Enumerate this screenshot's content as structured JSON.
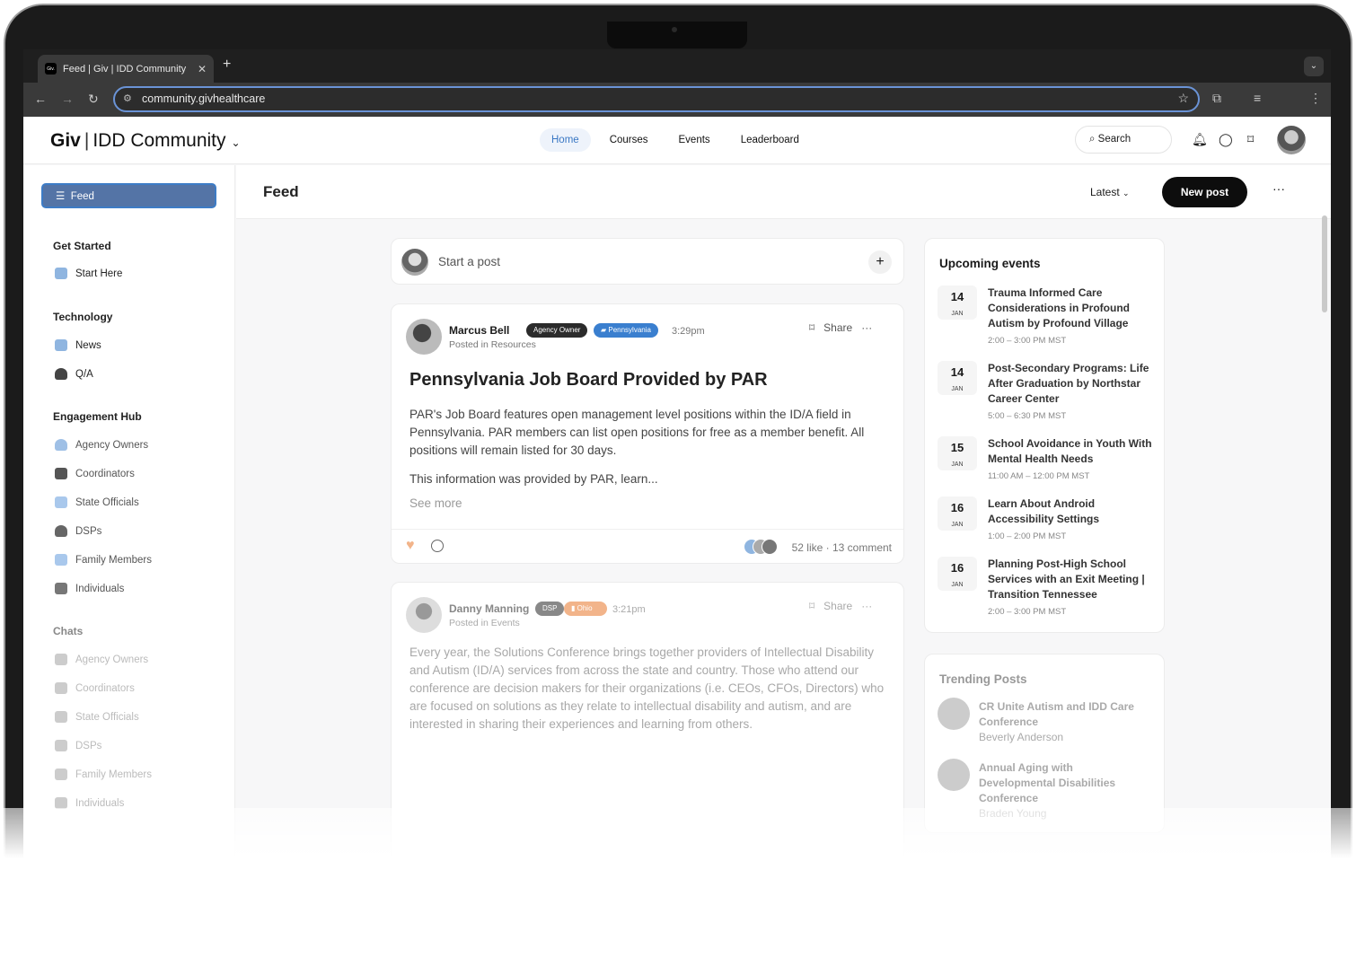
{
  "browser": {
    "tab_title": "Feed | Giv | IDD Community",
    "favicon_text": "Giv.",
    "url": "community.givhealthcare"
  },
  "header": {
    "brand": "Giv",
    "community": "IDD Community",
    "nav": [
      "Home",
      "Courses",
      "Events",
      "Leaderboard"
    ],
    "active_nav": "Home",
    "search_label": "Search"
  },
  "sidebar": {
    "feed": "Feed",
    "sections": [
      {
        "title": "Get Started",
        "items": [
          {
            "label": "Start Here",
            "icon": "g-logo-icon",
            "color": "#8fb5e0"
          }
        ]
      },
      {
        "title": "Technology",
        "items": [
          {
            "label": "News",
            "icon": "news-icon",
            "color": "#8fb5e0"
          },
          {
            "label": "Q/A",
            "icon": "person-icon",
            "color": "#444444"
          }
        ]
      },
      {
        "title": "Engagement Hub",
        "items": [
          {
            "label": "Agency Owners",
            "icon": "person-icon",
            "color": "#9fc0e6"
          },
          {
            "label": "Coordinators",
            "icon": "chat-icon",
            "color": "#555555"
          },
          {
            "label": "State Officials",
            "icon": "chats-icon",
            "color": "#a9c8ec"
          },
          {
            "label": "DSPs",
            "icon": "person-icon",
            "color": "#666666"
          },
          {
            "label": "Family Members",
            "icon": "chat-icon",
            "color": "#a9c8ec"
          },
          {
            "label": "Individuals",
            "icon": "chats-icon",
            "color": "#777777"
          }
        ]
      },
      {
        "title": "Chats",
        "items": [
          {
            "label": "Agency Owners",
            "icon": "chat-icon",
            "color": "#cccccc"
          },
          {
            "label": "Coordinators",
            "icon": "chat-icon",
            "color": "#cccccc"
          },
          {
            "label": "State Officials",
            "icon": "chat-icon",
            "color": "#cccccc"
          },
          {
            "label": "DSPs",
            "icon": "chat-icon",
            "color": "#cccccc"
          },
          {
            "label": "Family Members",
            "icon": "chat-icon",
            "color": "#cccccc"
          },
          {
            "label": "Individuals",
            "icon": "chat-icon",
            "color": "#cccccc"
          }
        ]
      }
    ]
  },
  "feed": {
    "title": "Feed",
    "sort": "Latest",
    "new_post": "New post",
    "start_post": "Start a post",
    "posts": [
      {
        "author": "Marcus Bell",
        "role": "Agency Owner",
        "state": "Pennsylvania",
        "time": "3:29pm",
        "posted_in": "Posted in Resources",
        "title": "Pennsylvania Job Board Provided by PAR",
        "body": "PAR's Job Board features open management level positions within the ID/A field in Pennsylvania. PAR members can list open positions for free as a member benefit. All positions will remain listed for 30 days.",
        "more": "This information was provided by PAR, learn...",
        "see_more": "See more",
        "likes": "52 like",
        "comments": "13 comment",
        "share": "Share"
      },
      {
        "author": "Danny Manning",
        "role": "DSP",
        "state": "Ohio",
        "time": "3:21pm",
        "posted_in": "Posted in Events",
        "body": "Every year, the Solutions Conference brings together providers of Intellectual Disability and Autism (ID/A) services from across the state and country. Those who attend our conference are decision makers for their organizations (i.e. CEOs, CFOs, Directors) who are focused on solutions as they relate to intellectual disability and autism, and are interested in sharing their experiences and learning from others.",
        "share": "Share"
      }
    ]
  },
  "events": {
    "title": "Upcoming events",
    "items": [
      {
        "day": "14",
        "month": "JAN",
        "title": "Trauma Informed Care Considerations in Profound Autism by Profound Village",
        "time": "2:00 – 3:00 PM MST"
      },
      {
        "day": "14",
        "month": "JAN",
        "title": "Post-Secondary Programs: Life After Graduation by Northstar Career Center",
        "time": "5:00 – 6:30 PM MST"
      },
      {
        "day": "15",
        "month": "JAN",
        "title": "School Avoidance in Youth With Mental Health Needs",
        "time": "11:00 AM – 12:00 PM MST"
      },
      {
        "day": "16",
        "month": "JAN",
        "title": "Learn About Android Accessibility Settings",
        "time": "1:00 – 2:00 PM MST"
      },
      {
        "day": "16",
        "month": "JAN",
        "title": "Planning Post-High School Services with an Exit Meeting | Transition Tennessee",
        "time": "2:00 – 3:00 PM MST"
      }
    ]
  },
  "trending": {
    "title": "Trending Posts",
    "items": [
      {
        "title": "CR Unite Autism and IDD Care Conference",
        "author": "Beverly Anderson"
      },
      {
        "title": "Annual Aging with Developmental Disabilities Conference",
        "author": "Braden Young"
      }
    ]
  },
  "colors": {
    "accent": "#3a78c4",
    "primary_button": "#0d0d0d",
    "role_badge": "#2b2b2b",
    "state_badge_pa": "#3a7fcf",
    "state_badge_oh": "#f2b48a",
    "like": "#f2b48a"
  }
}
